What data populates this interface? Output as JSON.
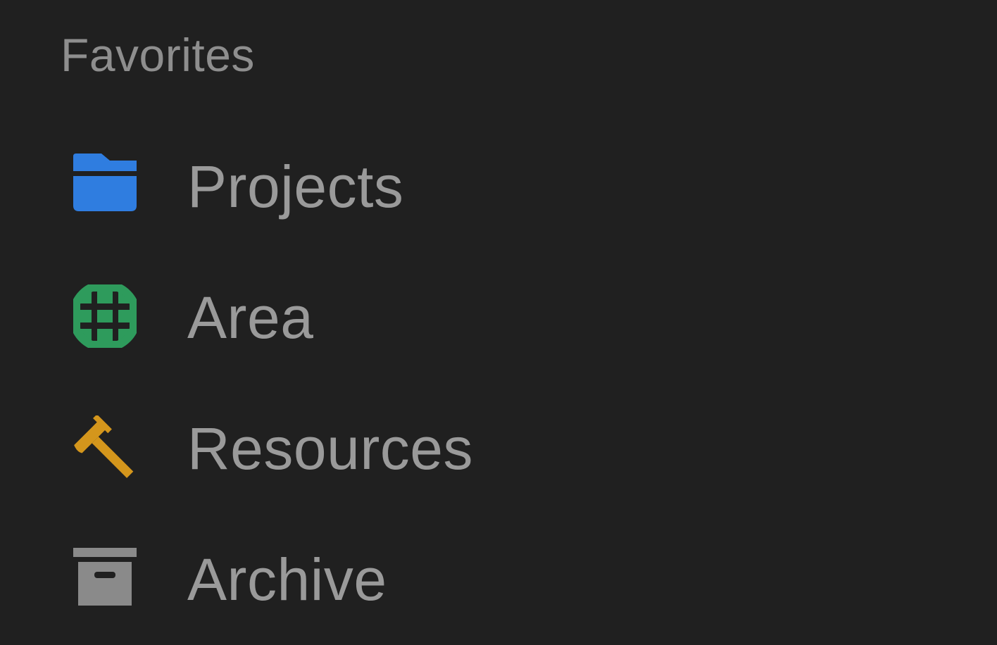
{
  "sidebar": {
    "section_title": "Favorites",
    "items": [
      {
        "label": "Projects",
        "icon": "folder-icon",
        "color": "#2f7de0"
      },
      {
        "label": "Area",
        "icon": "globe-icon",
        "color": "#2e9b5c"
      },
      {
        "label": "Resources",
        "icon": "hammer-icon",
        "color": "#d4961c"
      },
      {
        "label": "Archive",
        "icon": "archive-box-icon",
        "color": "#8a8a8a"
      }
    ]
  }
}
